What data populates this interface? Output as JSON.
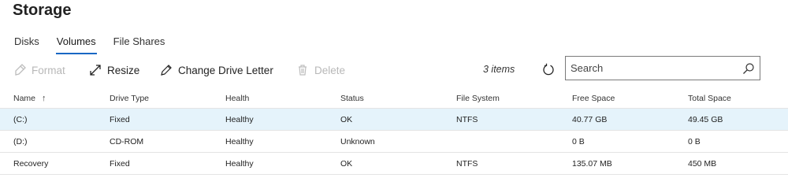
{
  "page": {
    "title": "Storage"
  },
  "tabs": [
    {
      "label": "Disks",
      "active": false
    },
    {
      "label": "Volumes",
      "active": true
    },
    {
      "label": "File Shares",
      "active": false
    }
  ],
  "toolbar": {
    "format_label": "Format",
    "resize_label": "Resize",
    "change_letter_label": "Change Drive Letter",
    "delete_label": "Delete",
    "item_count": "3 items"
  },
  "search": {
    "placeholder": "Search",
    "value": ""
  },
  "table": {
    "columns": [
      "Name",
      "Drive Type",
      "Health",
      "Status",
      "File System",
      "Free Space",
      "Total Space"
    ],
    "sort_indicator": "↑",
    "rows": [
      {
        "name": "(C:)",
        "drive_type": "Fixed",
        "health": "Healthy",
        "status": "OK",
        "file_system": "NTFS",
        "free_space": "40.77 GB",
        "total_space": "49.45 GB",
        "selected": true
      },
      {
        "name": "(D:)",
        "drive_type": "CD-ROM",
        "health": "Healthy",
        "status": "Unknown",
        "file_system": "",
        "free_space": "0 B",
        "total_space": "0 B",
        "selected": false
      },
      {
        "name": "Recovery",
        "drive_type": "Fixed",
        "health": "Healthy",
        "status": "OK",
        "file_system": "NTFS",
        "free_space": "135.07 MB",
        "total_space": "450 MB",
        "selected": false
      }
    ]
  },
  "icons": {
    "format": "format-icon",
    "resize": "resize-icon",
    "change_letter": "pencil-icon",
    "delete": "trash-icon",
    "refresh": "refresh-icon",
    "search": "search-icon"
  },
  "colors": {
    "accent": "#1a67c4",
    "selected_row": "#e5f3fb",
    "disabled_text": "#b8b8b8"
  }
}
